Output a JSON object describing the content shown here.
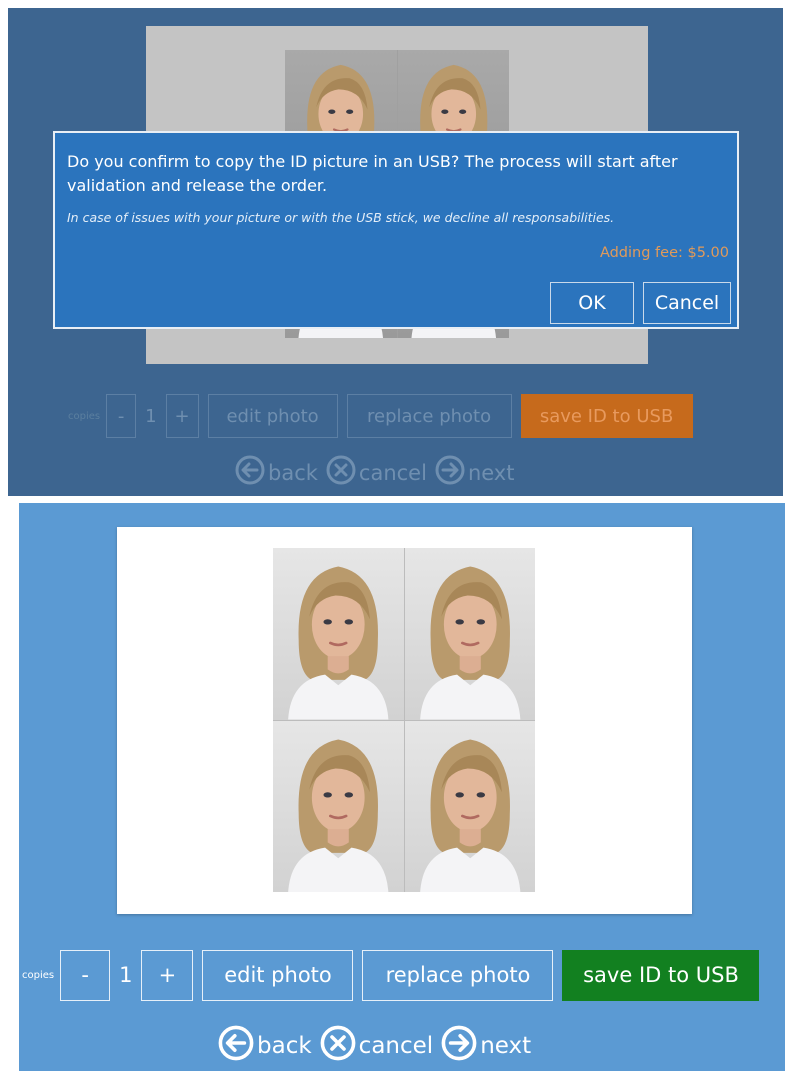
{
  "dialog_screen": {
    "dialog": {
      "message": "Do you confirm to copy the ID picture in an USB? The process will start after validation and release the order.",
      "note": "In case of issues with your picture or with the USB stick, we decline all responsabilities.",
      "fee": "Adding fee: $5.00",
      "ok_label": "OK",
      "cancel_label": "Cancel"
    },
    "toolbar": {
      "copies_label": "copies",
      "minus_label": "-",
      "count": "1",
      "plus_label": "+",
      "edit_label": "edit photo",
      "replace_label": "replace photo",
      "save_label": "save ID to USB",
      "save_color": "#c66a1c"
    },
    "nav": {
      "back_label": "back",
      "cancel_label": "cancel",
      "next_label": "next"
    }
  },
  "main_screen": {
    "toolbar": {
      "copies_label": "copies",
      "minus_label": "-",
      "count": "1",
      "plus_label": "+",
      "edit_label": "edit photo",
      "replace_label": "replace photo",
      "save_label": "save ID to USB",
      "save_color": "#128020"
    },
    "nav": {
      "back_label": "back",
      "cancel_label": "cancel",
      "next_label": "next"
    }
  },
  "icons": [
    "back-arrow-icon",
    "cancel-x-icon",
    "next-arrow-icon"
  ],
  "colors": {
    "accent": "#2b74bd",
    "background_top": "#3d6590",
    "background_bottom": "#5b9ad3"
  }
}
